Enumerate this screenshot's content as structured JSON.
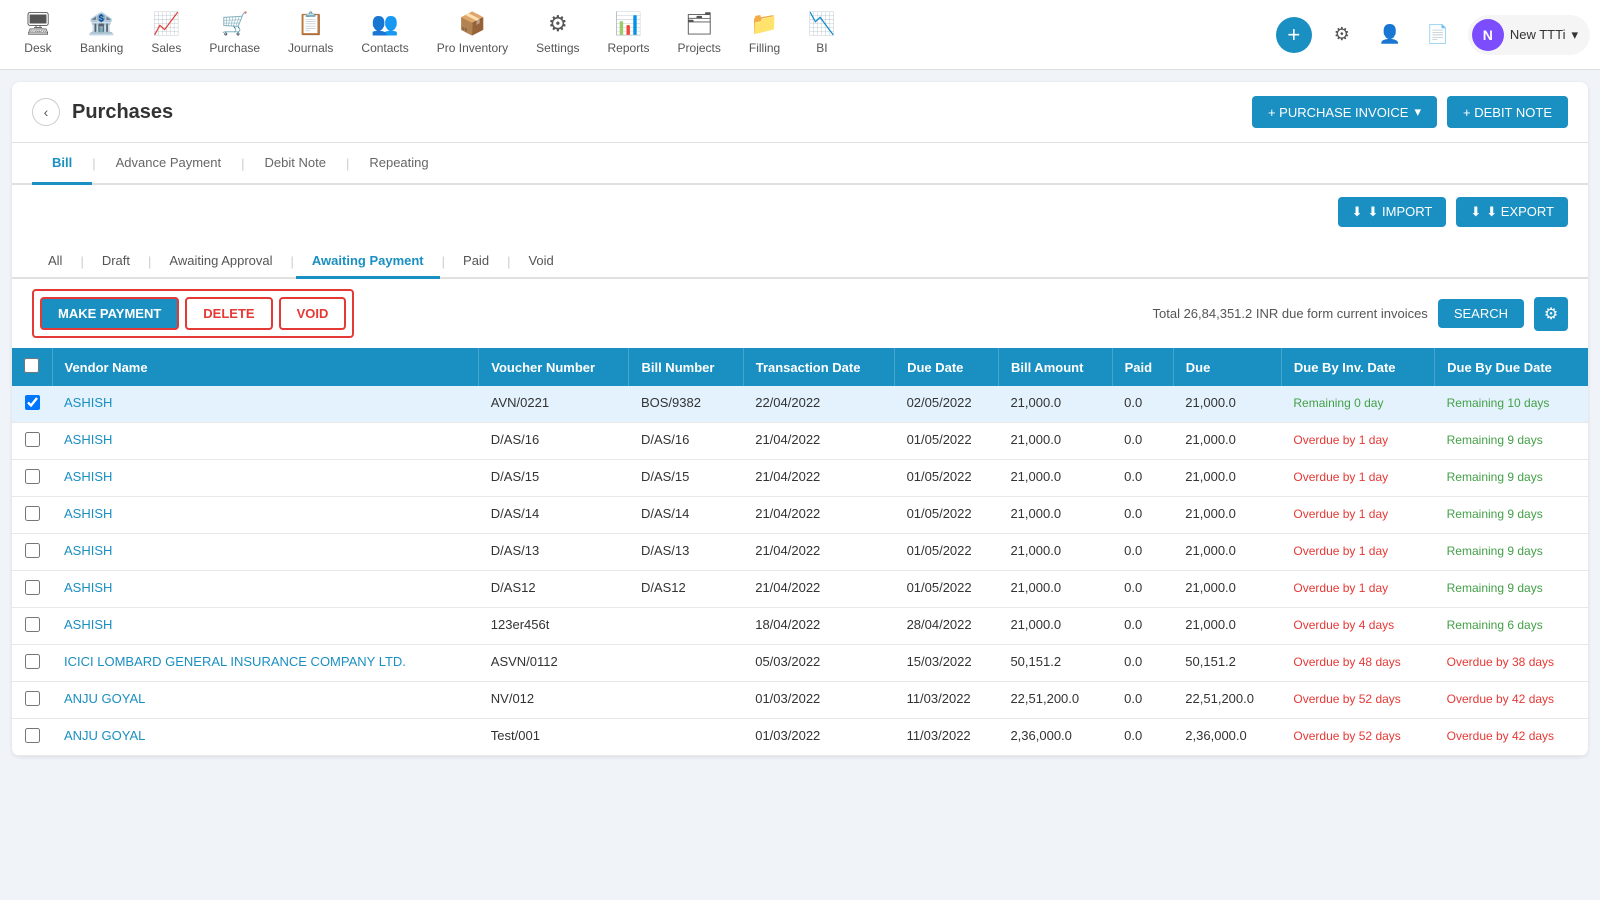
{
  "nav": {
    "items": [
      {
        "label": "Desk",
        "icon": "🖥"
      },
      {
        "label": "Banking",
        "icon": "🏦"
      },
      {
        "label": "Sales",
        "icon": "📈"
      },
      {
        "label": "Purchase",
        "icon": "🛒"
      },
      {
        "label": "Journals",
        "icon": "📋"
      },
      {
        "label": "Contacts",
        "icon": "👥"
      },
      {
        "label": "Pro Inventory",
        "icon": "📦"
      },
      {
        "label": "Settings",
        "icon": "⚙"
      },
      {
        "label": "Reports",
        "icon": "📊"
      },
      {
        "label": "Projects",
        "icon": "🗂"
      },
      {
        "label": "Filling",
        "icon": "📁"
      },
      {
        "label": "BI",
        "icon": "📉"
      }
    ],
    "user_label": "New TTTi",
    "user_avatar": "N",
    "plus_label": "+",
    "gear_icon": "⚙",
    "people_icon": "👤",
    "file_icon": "📄",
    "grid_icon": "⊞"
  },
  "page": {
    "back_label": "‹",
    "title": "Purchases",
    "btn_purchase_invoice": "+ PURCHASE INVOICE",
    "btn_debit_note": "+ DEBIT NOTE"
  },
  "tabs": [
    {
      "label": "Bill",
      "active": true
    },
    {
      "label": "Advance Payment",
      "active": false
    },
    {
      "label": "Debit Note",
      "active": false
    },
    {
      "label": "Repeating",
      "active": false
    }
  ],
  "filter": {
    "import_label": "⬇ IMPORT",
    "export_label": "⬇ EXPORT"
  },
  "status_tabs": [
    {
      "label": "All",
      "active": false
    },
    {
      "label": "Draft",
      "active": false
    },
    {
      "label": "Awaiting Approval",
      "active": false
    },
    {
      "label": "Awaiting Payment",
      "active": true
    },
    {
      "label": "Paid",
      "active": false
    },
    {
      "label": "Void",
      "active": false
    }
  ],
  "actions": {
    "make_payment": "MAKE PAYMENT",
    "delete": "DELETE",
    "void": "VOID",
    "total_info": "Total 26,84,351.2 INR due form current invoices",
    "search": "SEARCH"
  },
  "table": {
    "columns": [
      "Vendor Name",
      "Voucher Number",
      "Bill Number",
      "Transaction Date",
      "Due Date",
      "Bill Amount",
      "Paid",
      "Due",
      "Due By Inv. Date",
      "Due By Due Date"
    ],
    "rows": [
      {
        "checked": true,
        "vendor": "ASHISH",
        "voucher": "AVN/0221",
        "bill_number": "BOS/9382",
        "transaction_date": "22/04/2022",
        "due_date": "02/05/2022",
        "bill_amount": "21,000.0",
        "paid": "0.0",
        "due": "21,000.0",
        "due_by_inv": "Remaining 0 day",
        "due_by_inv_color": "green",
        "due_by_due": "Remaining 10 days",
        "due_by_due_color": "green"
      },
      {
        "checked": false,
        "vendor": "ASHISH",
        "voucher": "D/AS/16",
        "bill_number": "D/AS/16",
        "transaction_date": "21/04/2022",
        "due_date": "01/05/2022",
        "bill_amount": "21,000.0",
        "paid": "0.0",
        "due": "21,000.0",
        "due_by_inv": "Overdue by 1 day",
        "due_by_inv_color": "red",
        "due_by_due": "Remaining 9 days",
        "due_by_due_color": "green"
      },
      {
        "checked": false,
        "vendor": "ASHISH",
        "voucher": "D/AS/15",
        "bill_number": "D/AS/15",
        "transaction_date": "21/04/2022",
        "due_date": "01/05/2022",
        "bill_amount": "21,000.0",
        "paid": "0.0",
        "due": "21,000.0",
        "due_by_inv": "Overdue by 1 day",
        "due_by_inv_color": "red",
        "due_by_due": "Remaining 9 days",
        "due_by_due_color": "green"
      },
      {
        "checked": false,
        "vendor": "ASHISH",
        "voucher": "D/AS/14",
        "bill_number": "D/AS/14",
        "transaction_date": "21/04/2022",
        "due_date": "01/05/2022",
        "bill_amount": "21,000.0",
        "paid": "0.0",
        "due": "21,000.0",
        "due_by_inv": "Overdue by 1 day",
        "due_by_inv_color": "red",
        "due_by_due": "Remaining 9 days",
        "due_by_due_color": "green"
      },
      {
        "checked": false,
        "vendor": "ASHISH",
        "voucher": "D/AS/13",
        "bill_number": "D/AS/13",
        "transaction_date": "21/04/2022",
        "due_date": "01/05/2022",
        "bill_amount": "21,000.0",
        "paid": "0.0",
        "due": "21,000.0",
        "due_by_inv": "Overdue by 1 day",
        "due_by_inv_color": "red",
        "due_by_due": "Remaining 9 days",
        "due_by_due_color": "green"
      },
      {
        "checked": false,
        "vendor": "ASHISH",
        "voucher": "D/AS12",
        "bill_number": "D/AS12",
        "transaction_date": "21/04/2022",
        "due_date": "01/05/2022",
        "bill_amount": "21,000.0",
        "paid": "0.0",
        "due": "21,000.0",
        "due_by_inv": "Overdue by 1 day",
        "due_by_inv_color": "red",
        "due_by_due": "Remaining 9 days",
        "due_by_due_color": "green"
      },
      {
        "checked": false,
        "vendor": "ASHISH",
        "voucher": "123er456t",
        "bill_number": "",
        "transaction_date": "18/04/2022",
        "due_date": "28/04/2022",
        "bill_amount": "21,000.0",
        "paid": "0.0",
        "due": "21,000.0",
        "due_by_inv": "Overdue by 4 days",
        "due_by_inv_color": "red",
        "due_by_due": "Remaining 6 days",
        "due_by_due_color": "green"
      },
      {
        "checked": false,
        "vendor": "ICICI LOMBARD GENERAL INSURANCE COMPANY LTD.",
        "voucher": "ASVN/0112",
        "bill_number": "",
        "transaction_date": "05/03/2022",
        "due_date": "15/03/2022",
        "bill_amount": "50,151.2",
        "paid": "0.0",
        "due": "50,151.2",
        "due_by_inv": "Overdue by 48 days",
        "due_by_inv_color": "red",
        "due_by_due": "Overdue by 38 days",
        "due_by_due_color": "red"
      },
      {
        "checked": false,
        "vendor": "ANJU GOYAL",
        "voucher": "NV/012",
        "bill_number": "",
        "transaction_date": "01/03/2022",
        "due_date": "11/03/2022",
        "bill_amount": "22,51,200.0",
        "paid": "0.0",
        "due": "22,51,200.0",
        "due_by_inv": "Overdue by 52 days",
        "due_by_inv_color": "red",
        "due_by_due": "Overdue by 42 days",
        "due_by_due_color": "red"
      },
      {
        "checked": false,
        "vendor": "ANJU GOYAL",
        "voucher": "Test/001",
        "bill_number": "",
        "transaction_date": "01/03/2022",
        "due_date": "11/03/2022",
        "bill_amount": "2,36,000.0",
        "paid": "0.0",
        "due": "2,36,000.0",
        "due_by_inv": "Overdue by 52 days",
        "due_by_inv_color": "red",
        "due_by_due": "Overdue by 42 days",
        "due_by_due_color": "red"
      }
    ]
  },
  "colors": {
    "primary": "#1a8fc1",
    "danger": "#e53935",
    "success": "#43a047"
  }
}
